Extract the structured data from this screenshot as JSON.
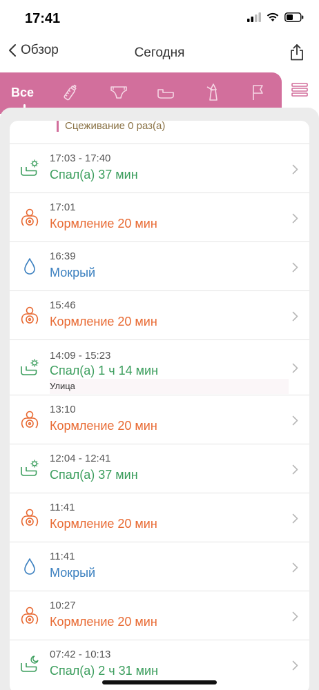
{
  "status": {
    "time": "17:41"
  },
  "nav": {
    "back_label": "Обзор",
    "title": "Сегодня"
  },
  "tabs": {
    "all_label": "Все"
  },
  "summary": {
    "text": "Сцеживание 0 раз(а)"
  },
  "colors": {
    "accent": "#d26f9c",
    "sleep": "#3a9d5c",
    "feed": "#e86a33",
    "wet": "#3a7fbf"
  },
  "entries": [
    {
      "type": "sleep",
      "icon": "sleep-icon",
      "time": "17:03 - 17:40",
      "title": "Спал(а) 37 мин"
    },
    {
      "type": "feed",
      "icon": "feeding-icon",
      "time": "17:01",
      "title": "Кормление  20 мин"
    },
    {
      "type": "wet",
      "icon": "drop-icon",
      "time": "16:39",
      "title": "Мокрый"
    },
    {
      "type": "feed",
      "icon": "feeding-icon",
      "time": "15:46",
      "title": "Кормление  20 мин"
    },
    {
      "type": "sleep",
      "icon": "sleep-icon",
      "time": "14:09 - 15:23",
      "title": "Спал(а) 1 ч 14 мин",
      "note": "Улица"
    },
    {
      "type": "feed",
      "icon": "feeding-icon",
      "time": "13:10",
      "title": "Кормление  20 мин"
    },
    {
      "type": "sleep",
      "icon": "sleep-icon",
      "time": "12:04 - 12:41",
      "title": "Спал(а) 37 мин"
    },
    {
      "type": "feed",
      "icon": "feeding-icon",
      "time": "11:41",
      "title": "Кормление  20 мин"
    },
    {
      "type": "wet",
      "icon": "drop-icon",
      "time": "11:41",
      "title": "Мокрый"
    },
    {
      "type": "feed",
      "icon": "feeding-icon",
      "time": "10:27",
      "title": "Кормление  20 мин"
    },
    {
      "type": "sleep-night",
      "icon": "night-sleep-icon",
      "time": "07:42 - 10:13",
      "title": "Спал(а) 2 ч 31 мин"
    }
  ]
}
